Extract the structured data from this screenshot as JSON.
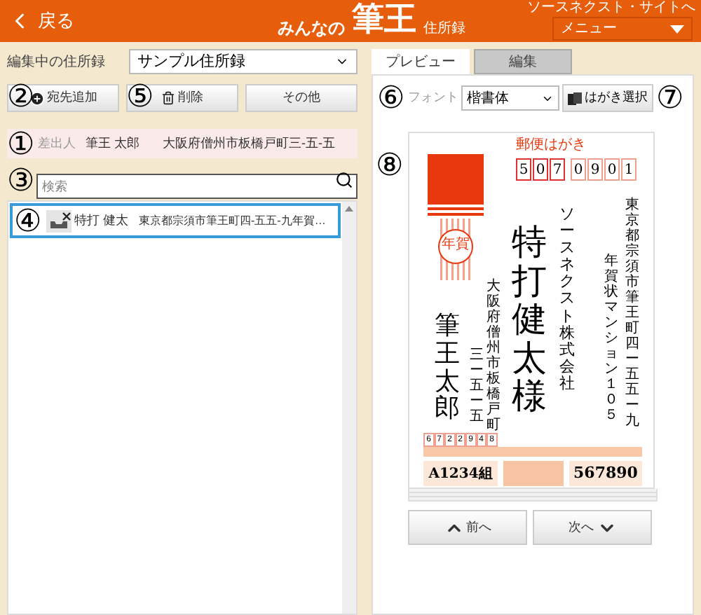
{
  "header": {
    "back": "戻る",
    "logo": {
      "prefix": "みんなの",
      "brand": "筆王",
      "suffix": "住所録"
    },
    "site_link": "ソースネクスト・サイトへ",
    "menu": "メニュー"
  },
  "address_book": {
    "label": "編集中の住所録",
    "value": "サンプル住所録"
  },
  "toolbar": [
    {
      "label": "宛先追加",
      "kind": "add",
      "callout": "②"
    },
    {
      "label": "削除",
      "kind": "delete",
      "callout": "⑤"
    },
    {
      "label": "その他",
      "kind": "plain"
    }
  ],
  "sender": {
    "callout": "①",
    "label": "差出人",
    "name": "筆王 太郎",
    "address": "大阪府僧州市板橋戸町三-五-五"
  },
  "search": {
    "callout": "③",
    "placeholder": "検索"
  },
  "list": {
    "callout": "④",
    "items": [
      {
        "name": "特打 健太",
        "address": "東京都宗須市筆王町四-五五-九年賀…",
        "selected": true
      }
    ]
  },
  "tabs": [
    {
      "label": "プレビュー",
      "selected": true
    },
    {
      "label": "編集",
      "selected": false
    }
  ],
  "font": {
    "callout": "⑥",
    "label": "フォント",
    "value": "楷書体"
  },
  "card_select": {
    "label": "はがき選択",
    "callout": "⑦"
  },
  "preview": {
    "callout": "⑧",
    "postal_label": "郵便はがき",
    "postal_code": [
      "5",
      "0",
      "7",
      "0",
      "9",
      "0",
      "1"
    ],
    "stamp_text": "年賀",
    "recipient_address": [
      "東京都宗須市筆王町四ー五五ー九",
      "年賀状マンション１０５"
    ],
    "company": "ソースネクスト株式会社",
    "recipient_name": "特打健太様",
    "sender_address": [
      "大阪府僧州市板橋戸町",
      "三ー五ー五"
    ],
    "sender_name": "筆王太郎",
    "sender_postal_code": [
      "6",
      "7",
      "2",
      "2",
      "9",
      "4",
      "8"
    ],
    "lottery": {
      "group": "A1234組",
      "number": "567890"
    }
  },
  "nav": [
    {
      "label": "前へ",
      "kind": "prev"
    },
    {
      "label": "次へ",
      "kind": "next"
    }
  ]
}
